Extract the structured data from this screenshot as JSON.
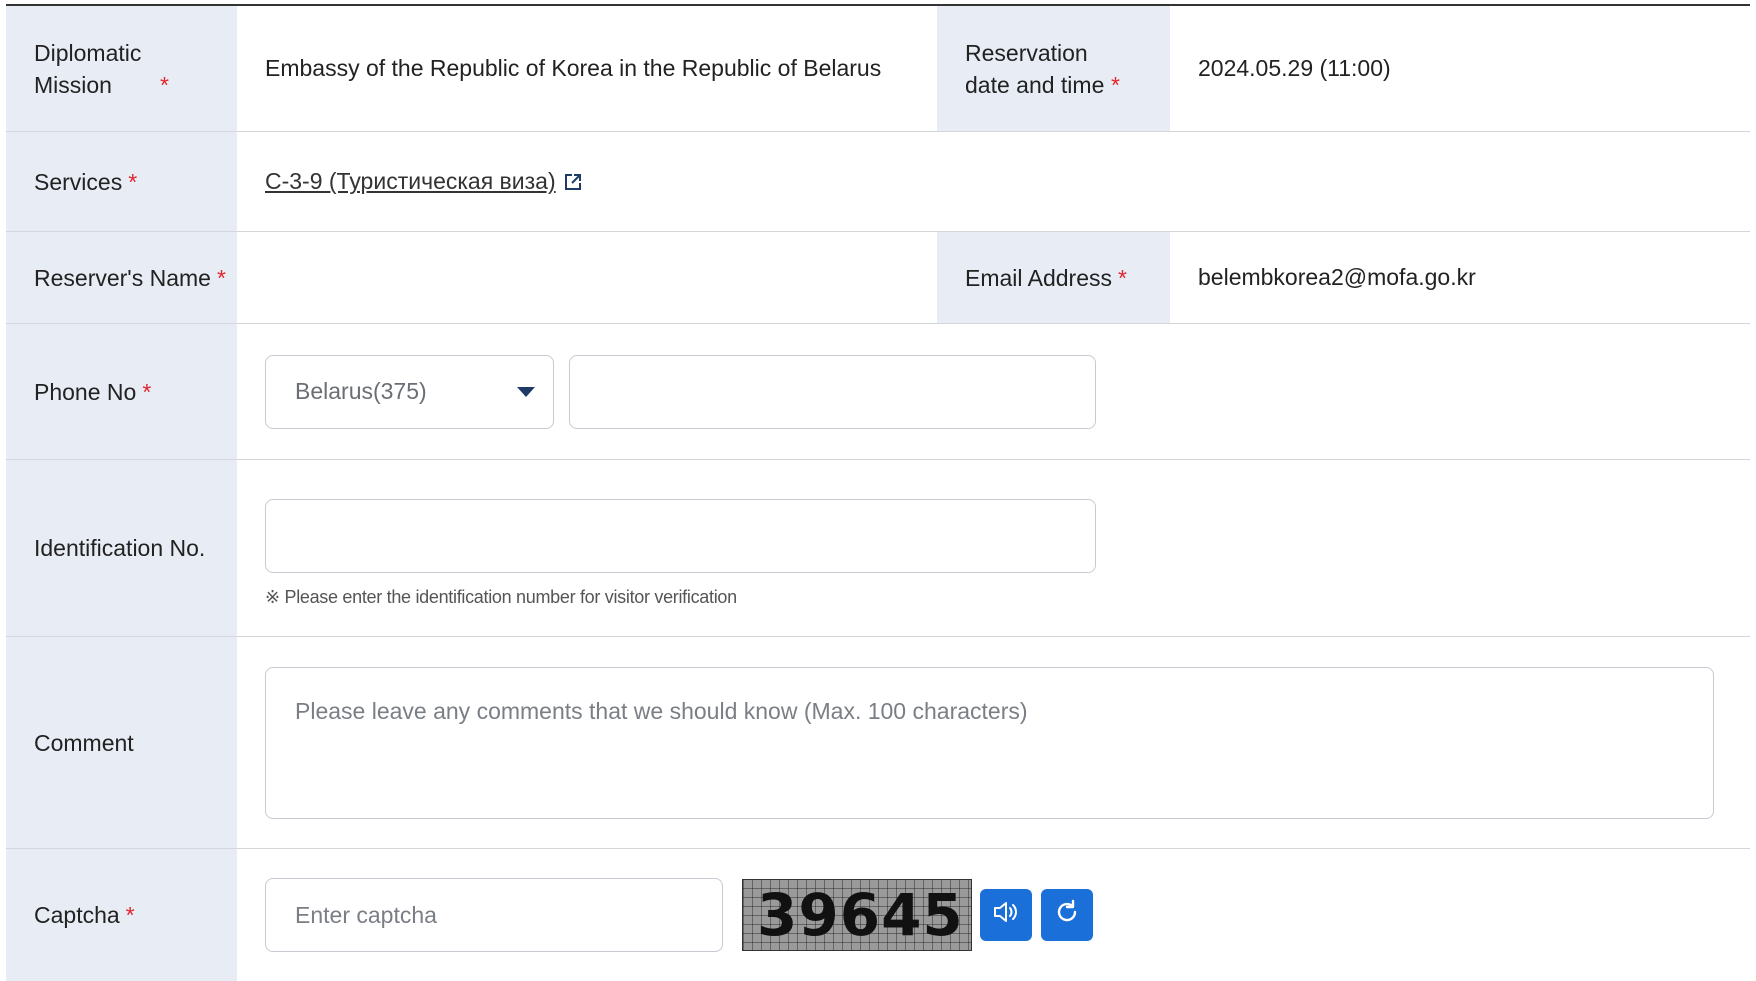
{
  "mission": {
    "label": "Diplomatic Mission",
    "value": "Embassy of the Republic of Korea in the Republic of Belarus"
  },
  "reservation": {
    "label": "Reservation date and time",
    "value": "2024.05.29 (11:00)"
  },
  "services": {
    "label": "Services",
    "link": "С-3-9 (Туристическая виза)"
  },
  "reserver": {
    "label": "Reserver's Name",
    "value": ""
  },
  "email": {
    "label": "Email Address",
    "value": "belembkorea2@mofa.go.kr"
  },
  "phone": {
    "label": "Phone No",
    "country": "Belarus(375)",
    "number": ""
  },
  "identification": {
    "label": "Identification No.",
    "value": "",
    "note": "※ Please enter the identification number for visitor verification"
  },
  "comment": {
    "label": "Comment",
    "placeholder": "Please leave any comments that we should know (Max. 100 characters)"
  },
  "captcha": {
    "label": "Captcha",
    "placeholder": "Enter captcha",
    "code": "39645"
  },
  "required_mark": "*",
  "colors": {
    "label_bg": "#e8edf5",
    "required": "#e0262e",
    "button": "#1a6fd8"
  },
  "icons": [
    "external-link-icon",
    "dropdown-arrow-icon",
    "audio-icon",
    "refresh-icon"
  ]
}
